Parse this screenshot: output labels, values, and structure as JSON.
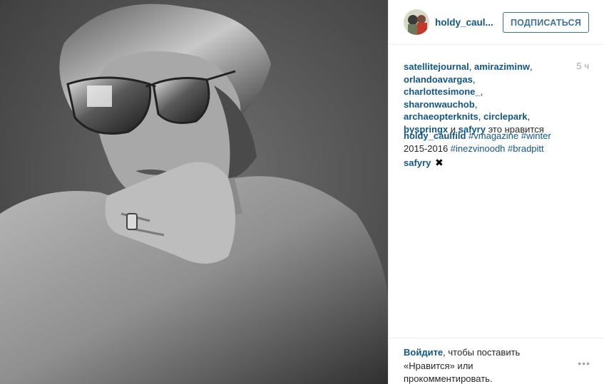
{
  "header": {
    "username": "holdy_caul...",
    "follow_label": "ПОДПИСАТЬСЯ"
  },
  "likes": {
    "users": [
      "satellitejournal",
      "amiraziminw",
      "orlandoavargas",
      "charlottesimone_",
      "sharonwauchob",
      "archaeopterknits",
      "circlepark",
      "byspringx"
    ],
    "last_user": "safyry",
    "sep": ",",
    "and": "и",
    "suffix": "это нравится"
  },
  "time": "5 ч",
  "comments": [
    {
      "user": "holdy_caulfild",
      "tag1": "#vmagazine",
      "tag2": "#winter",
      "mid": "2015-2016",
      "tag3": "#inezvinoodh",
      "tag4": "#bradpitt"
    },
    {
      "user": "safyry",
      "emoji": "✖"
    }
  ],
  "footer": {
    "login_link": "Войдите",
    "login_rest": ", чтобы поставить «Нравится» или прокомментировать.",
    "more": "•••"
  },
  "colors": {
    "link": "#125688",
    "follow": "#3f729b",
    "muted": "#a5a7aa",
    "border": "#efefef"
  },
  "icons": {
    "more": "more-options-icon",
    "clover": "clover-emoji-icon"
  }
}
